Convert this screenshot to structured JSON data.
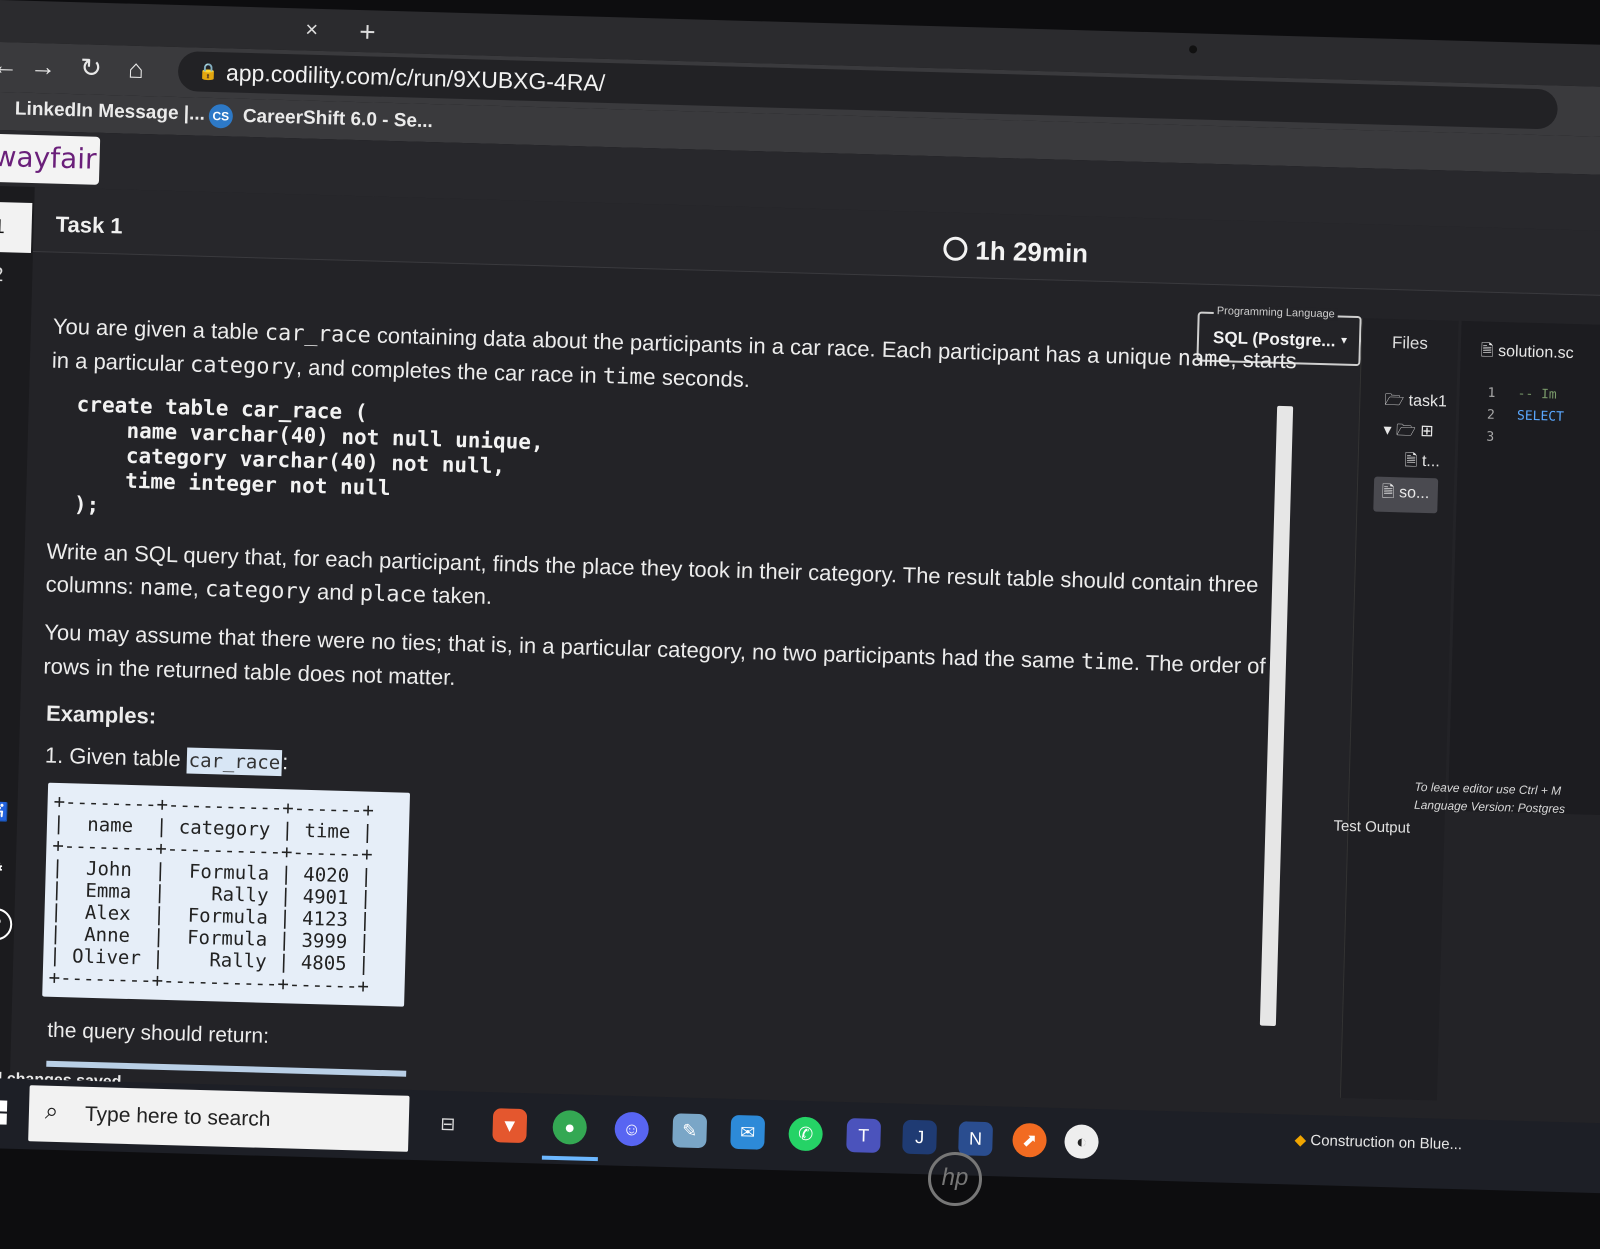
{
  "browser": {
    "tab_close": "×",
    "tab_new": "+",
    "url": "app.codility.com/c/run/9XUBXG-4RA/",
    "bookmarks": [
      "LinkedIn Message |...",
      "CareerShift 6.0 - Se..."
    ],
    "bookmark_icon_text": "CS"
  },
  "brand": {
    "logo": "wayfair"
  },
  "leftrail": {
    "num1": "1",
    "num2": "2"
  },
  "task": {
    "title": "Task 1",
    "timer": "1h 29min"
  },
  "description": {
    "p1_a": "You are given a table ",
    "p1_code": "car_race",
    "p1_b": " containing data about the participants in a car race. Each participant has a unique ",
    "p1_code2": "name",
    "p1_c": ", starts in a particular ",
    "p1_code3": "category",
    "p1_d": ", and completes the car race in ",
    "p1_code4": "time",
    "p1_e": " seconds.",
    "code": "create table car_race (\n    name varchar(40) not null unique,\n    category varchar(40) not null,\n    time integer not null\n);",
    "p2_a": "Write an SQL query that, for each participant, finds the place they took in their category. The result table should contain three columns: ",
    "p2_code": "name",
    "p2_b": ", ",
    "p2_code2": "category",
    "p2_c": " and ",
    "p2_code3": "place",
    "p2_d": " taken.",
    "p3_a": "You may assume that there were no ties; that is, in a particular category, no two participants had the same ",
    "p3_code": "time",
    "p3_b": ". The order of rows in the returned table does not matter.",
    "examples_label": "Examples:",
    "given_label": "1. Given table ",
    "given_code": "car_race",
    "given_colon": ":",
    "table_text": "+--------+----------+------+\n|  name  | category | time |\n+--------+----------+------+\n|  John  |  Formula | 4020 |\n|  Emma  |    Rally | 4901 |\n|  Alex  |  Formula | 4123 |\n|  Anne  |  Formula | 3999 |\n| Oliver |    Rally | 4805 |\n+--------+----------+------+",
    "should_return": "the query should return:"
  },
  "language_selector": {
    "label": "Programming Language",
    "value": "SQL (Postgre..."
  },
  "files": {
    "header": "Files",
    "tree": [
      "task1",
      "t...",
      "so..."
    ]
  },
  "editor": {
    "tab": "solution.sc",
    "line_numbers": [
      "1",
      "2",
      "3"
    ],
    "lines": [
      "-- Im",
      "SELECT",
      ""
    ],
    "hint1": "To leave editor use Ctrl + M",
    "hint2": "Language Version: Postgres"
  },
  "test_output": "Test Output",
  "status": "All changes saved",
  "taskbar": {
    "search_placeholder": "Type here to search",
    "notification": "Construction on Blue...",
    "hp": "hp"
  },
  "colors": {
    "page_bg": "#232327",
    "highlight_bg": "#d8e6f5",
    "logo_text": "#6a1f7a",
    "chrome_dark": "#2b2b2e"
  }
}
